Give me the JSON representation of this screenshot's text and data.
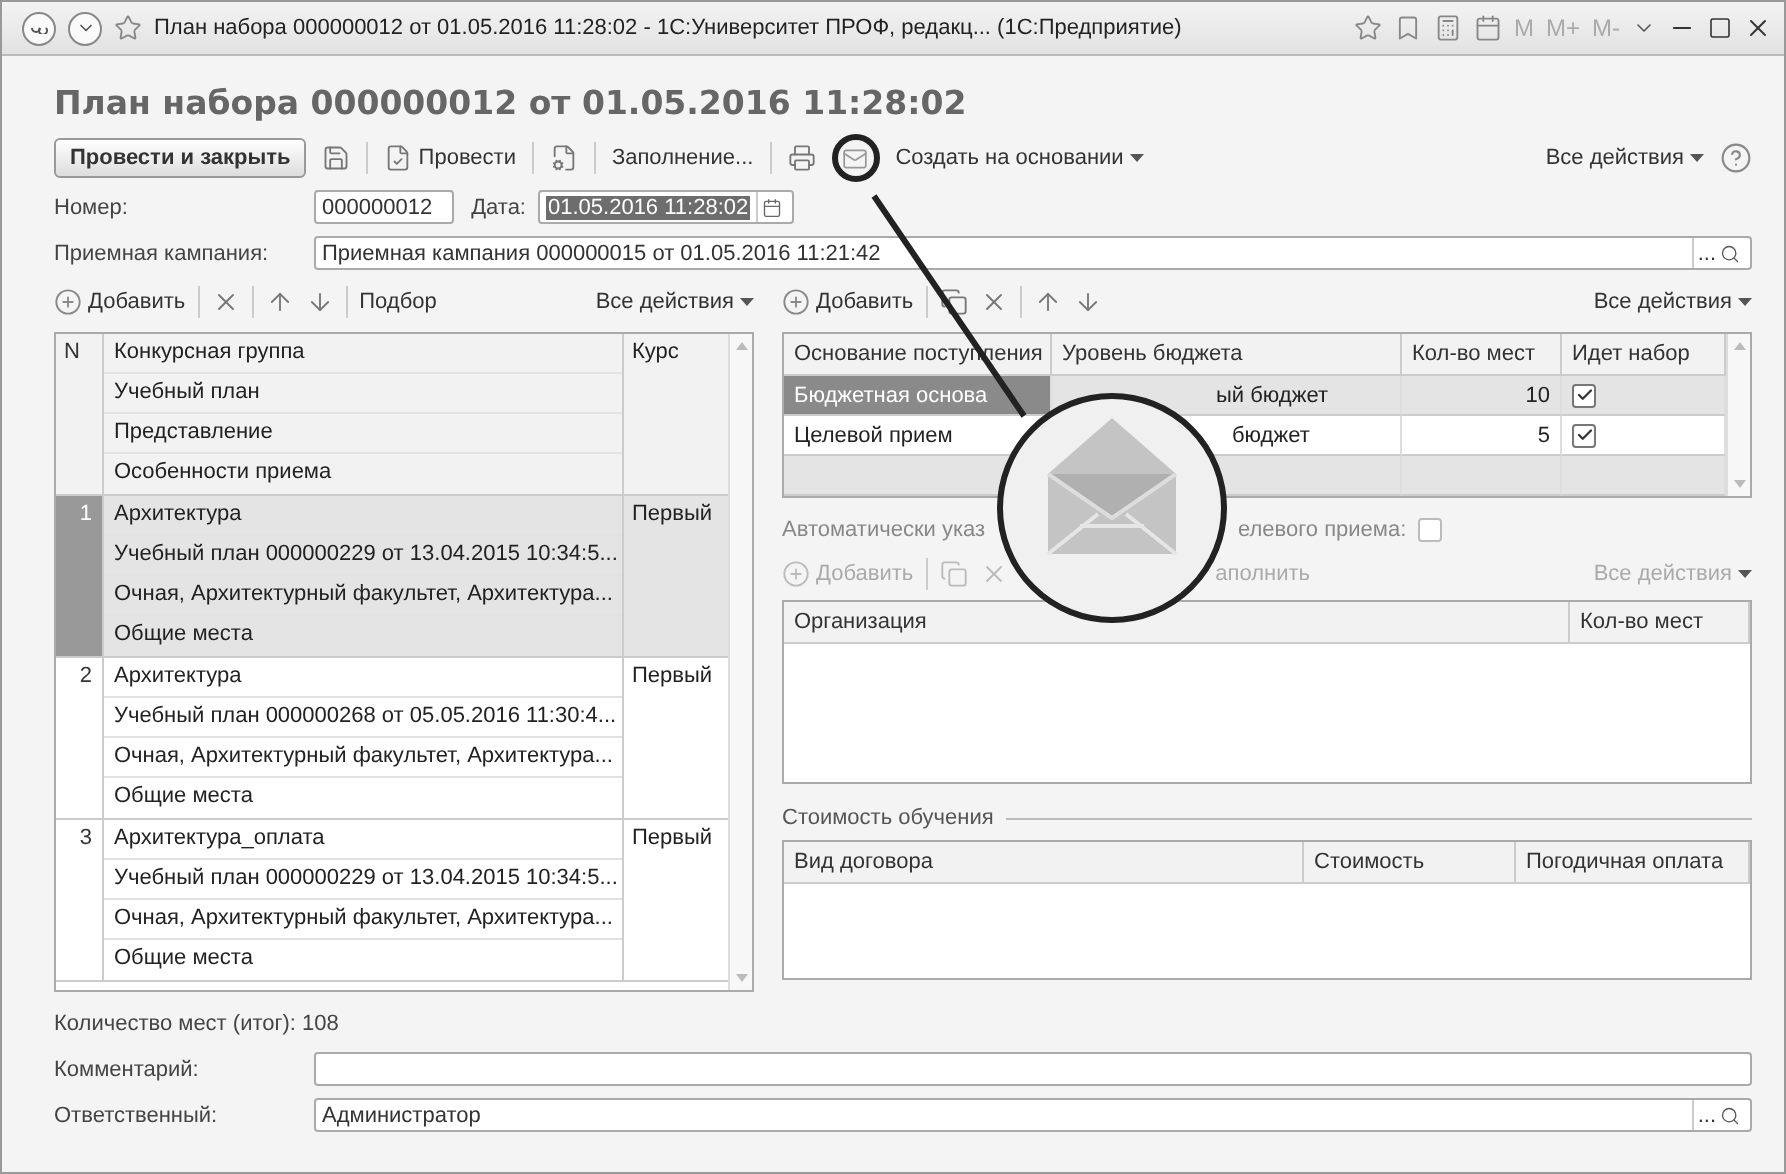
{
  "title_bar": {
    "title": "План набора 000000012 от 01.05.2016 11:28:02 - 1С:Университет ПРОФ, редакц...  (1С:Предприятие)",
    "memory_buttons": [
      "M",
      "M+",
      "M-"
    ]
  },
  "form_title": "План набора 000000012 от 01.05.2016 11:28:02",
  "toolbar": {
    "primary": "Провести и закрыть",
    "post": "Провести",
    "fill": "Заполнение...",
    "create_based": "Создать на основании",
    "all_actions": "Все действия"
  },
  "number": {
    "label": "Номер:",
    "value": "000000012"
  },
  "date": {
    "label": "Дата:",
    "value": "01.05.2016 11:28:02",
    "highlighted": true
  },
  "campaign": {
    "label": "Приемная кампания:",
    "value": "Приемная кампания 000000015 от 01.05.2016 11:21:42",
    "more": "..."
  },
  "groups": {
    "toolbar": {
      "add": "Добавить",
      "pick": "Подбор",
      "all_actions": "Все действия"
    },
    "columns": {
      "n": "N",
      "lines": [
        "Конкурсная группа",
        "Учебный план",
        "Представление",
        "Особенности приема"
      ],
      "course": "Курс"
    },
    "rows": [
      {
        "n": "1",
        "selected": true,
        "lines": [
          "Архитектура",
          "Учебный план 000000229 от 13.04.2015 10:34:5...",
          "Очная, Архитектурный факультет, Архитектура...",
          "Общие места"
        ],
        "course": "Первый"
      },
      {
        "n": "2",
        "selected": false,
        "lines": [
          "Архитектура",
          "Учебный план 000000268 от 05.05.2016 11:30:4...",
          "Очная, Архитектурный факультет, Архитектура...",
          "Общие места"
        ],
        "course": "Первый"
      },
      {
        "n": "3",
        "selected": false,
        "lines": [
          "Архитектура_оплата",
          "Учебный план 000000229 от 13.04.2015 10:34:5...",
          "Очная, Архитектурный факультет, Архитектура...",
          "Общие места"
        ],
        "course": "Первый"
      }
    ]
  },
  "budget": {
    "toolbar": {
      "add": "Добавить",
      "all_actions": "Все действия"
    },
    "columns": [
      "Основание поступления",
      "Уровень бюджета",
      "Кол-во мест",
      "Идет набор"
    ],
    "rows": [
      {
        "basis": "Бюджетная основа",
        "level": "ый бюджет",
        "places": "10",
        "recruiting": true,
        "selected": true
      },
      {
        "basis": "Целевой прием",
        "level": "бюджет",
        "places": "5",
        "recruiting": true,
        "selected": false
      }
    ]
  },
  "auto": {
    "label_start": "Автоматически указ",
    "label_end": "елевого приема:",
    "checked": false
  },
  "orgs": {
    "toolbar": {
      "add": "Добавить",
      "fill": "аполнить",
      "all_actions": "Все действия",
      "disabled": true
    },
    "columns": [
      "Организация",
      "Кол-во мест"
    ]
  },
  "cost": {
    "title": "Стоимость обучения",
    "columns": [
      "Вид договора",
      "Стоимость",
      "Погодичная оплата"
    ]
  },
  "total": "Количество мест (итог): 108",
  "comment": {
    "label": "Комментарий:"
  },
  "responsible": {
    "label": "Ответственный:",
    "value": "Администратор",
    "more": "..."
  }
}
